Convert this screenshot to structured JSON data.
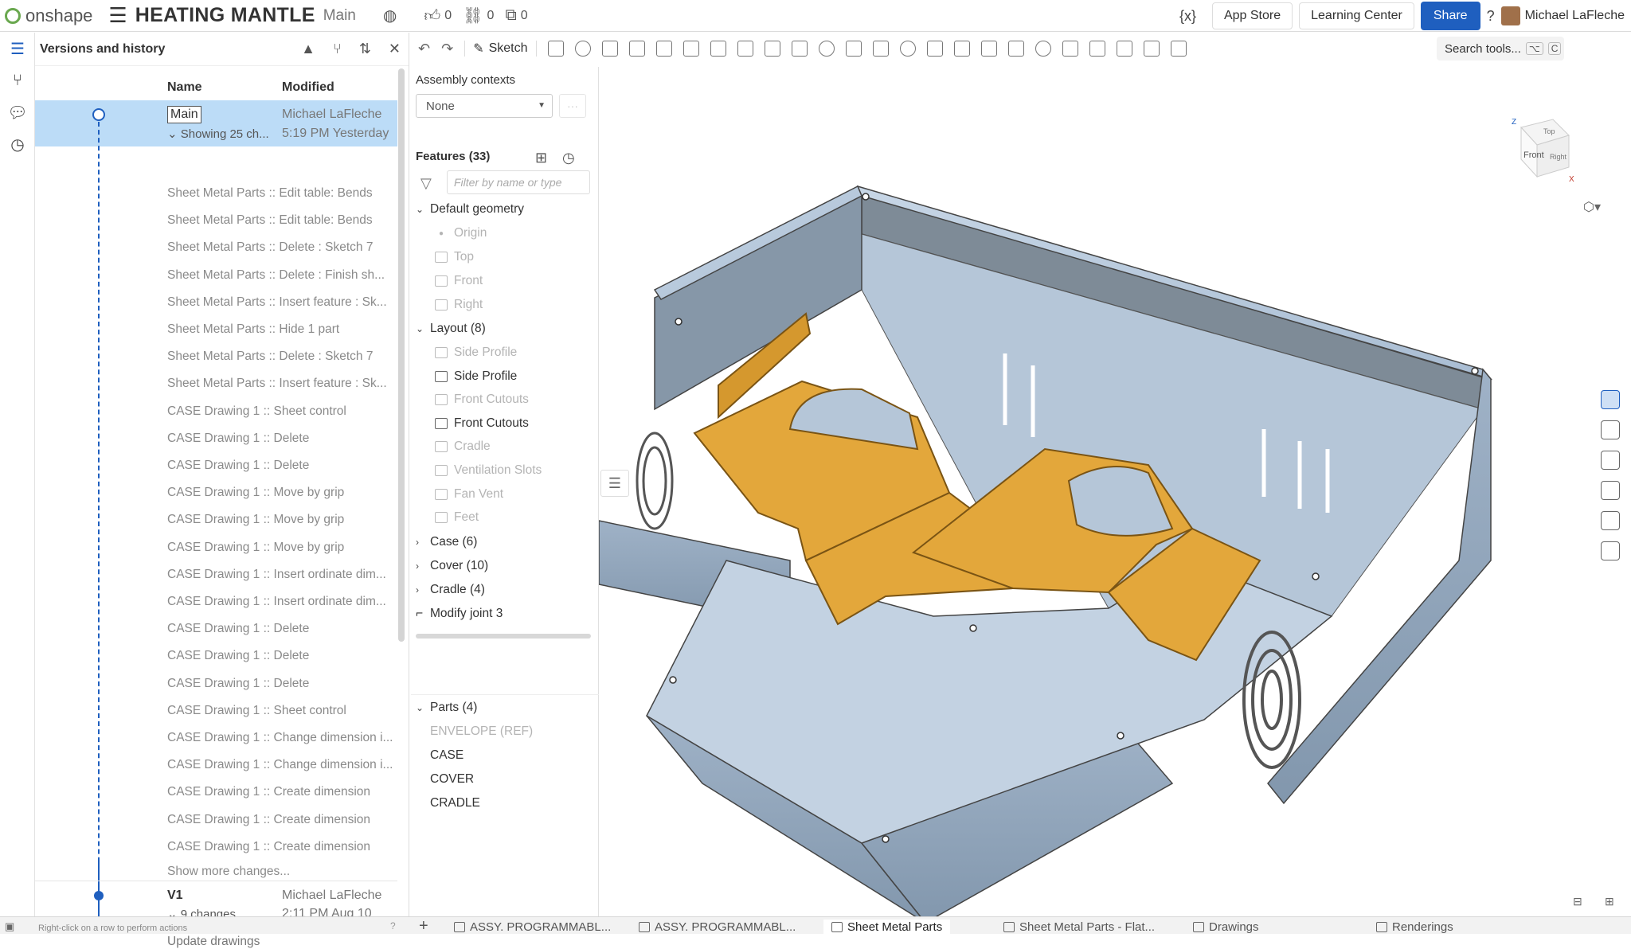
{
  "topbar": {
    "brand": "onshape",
    "doc_title": "HEATING MANTLE",
    "branch": "Main",
    "likes": "0",
    "links": "0",
    "copies": "0",
    "variable_icon": "{x}",
    "app_store": "App Store",
    "learning_center": "Learning Center",
    "share": "Share",
    "help": "?",
    "user": "Michael LaFleche"
  },
  "versions_panel": {
    "title": "Versions and history",
    "col_name": "Name",
    "col_modified": "Modified",
    "main": {
      "label": "Main",
      "sub": "Showing 25 ch...",
      "who": "Michael LaFleche",
      "when": "5:19 PM Yesterday"
    },
    "changes": [
      "Sheet Metal Parts :: Edit table: Bends",
      "Sheet Metal Parts :: Edit table: Bends",
      "Sheet Metal Parts :: Delete : Sketch 7",
      "Sheet Metal Parts :: Delete : Finish sh...",
      "Sheet Metal Parts :: Insert feature : Sk...",
      "Sheet Metal Parts :: Hide 1 part",
      "Sheet Metal Parts :: Delete : Sketch 7",
      "Sheet Metal Parts :: Insert feature : Sk...",
      "CASE Drawing 1 :: Sheet control",
      "CASE Drawing 1 :: Delete",
      "CASE Drawing 1 :: Delete",
      "CASE Drawing 1 :: Move by grip",
      "CASE Drawing 1 :: Move by grip",
      "CASE Drawing 1 :: Move by grip",
      "CASE Drawing 1 :: Insert ordinate dim...",
      "CASE Drawing 1 :: Insert ordinate dim...",
      "CASE Drawing 1 :: Delete",
      "CASE Drawing 1 :: Delete",
      "CASE Drawing 1 :: Delete",
      "CASE Drawing 1 :: Sheet control",
      "CASE Drawing 1 :: Change dimension i...",
      "CASE Drawing 1 :: Change dimension i...",
      "CASE Drawing 1 :: Create dimension",
      "CASE Drawing 1 :: Create dimension",
      "CASE Drawing 1 :: Create dimension"
    ],
    "show_more": "Show more changes...",
    "v1": {
      "label": "V1",
      "sub": "9 changes",
      "who": "Michael LaFleche",
      "when": "2:11 PM Aug 10"
    },
    "update": "Update drawings",
    "status_hint": "Right-click on a row to perform actions"
  },
  "toolbar": {
    "sketch": "Sketch",
    "search_tools": "Search tools...",
    "shortcut_1": "⌥",
    "shortcut_2": "C"
  },
  "feature_panel": {
    "assembly_contexts": "Assembly contexts",
    "assembly_select": "None",
    "dots": "···",
    "features_title": "Features (33)",
    "filter_placeholder": "Filter by name or type",
    "default_geometry": "Default geometry",
    "origin": "Origin",
    "top": "Top",
    "front": "Front",
    "right": "Right",
    "layout": "Layout (8)",
    "layout_items": [
      "Side Profile",
      "Side Profile",
      "Front Cutouts",
      "Front Cutouts",
      "Cradle",
      "Ventilation Slots",
      "Fan Vent",
      "Feet"
    ],
    "case": "Case (6)",
    "cover": "Cover (10)",
    "cradle": "Cradle (4)",
    "modify_joint": "Modify joint 3",
    "parts_title": "Parts (4)",
    "parts": [
      "ENVELOPE (REF)",
      "CASE",
      "COVER",
      "CRADLE"
    ]
  },
  "viewcube": {
    "top": "Top",
    "front": "Front",
    "right": "Right",
    "z": "Z",
    "x": "X"
  },
  "tabs": [
    "ASSY. PROGRAMMABL...",
    "ASSY. PROGRAMMABL...",
    "Sheet Metal Parts",
    "Sheet Metal Parts - Flat...",
    "Drawings",
    "Renderings"
  ],
  "colors": {
    "accent": "#1f5fbf",
    "selected_row": "#bcdcf7",
    "case_metal": "#b9cbde",
    "cradle": "#e3a73b"
  }
}
